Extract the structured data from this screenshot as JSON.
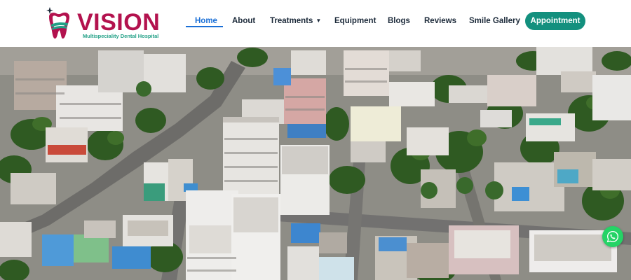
{
  "brand": {
    "name": "VISION",
    "tagline": "Multispeciality Dental Hospital",
    "colors": {
      "primary": "#b3124e",
      "accent": "#22a086"
    }
  },
  "nav": {
    "items": [
      {
        "label": "Home",
        "active": true
      },
      {
        "label": "About"
      },
      {
        "label": "Treatments",
        "has_dropdown": true
      },
      {
        "label": "Equipment"
      },
      {
        "label": "Blogs"
      },
      {
        "label": "Reviews"
      },
      {
        "label": "Smile Gallery"
      }
    ],
    "cta_label": "Appointment",
    "colors": {
      "active": "#1a6fd6",
      "cta": "#13907e"
    }
  },
  "hero": {
    "image": "aerial-city-photo"
  },
  "floating": {
    "icon": "whatsapp-icon",
    "color": "#25d366"
  }
}
